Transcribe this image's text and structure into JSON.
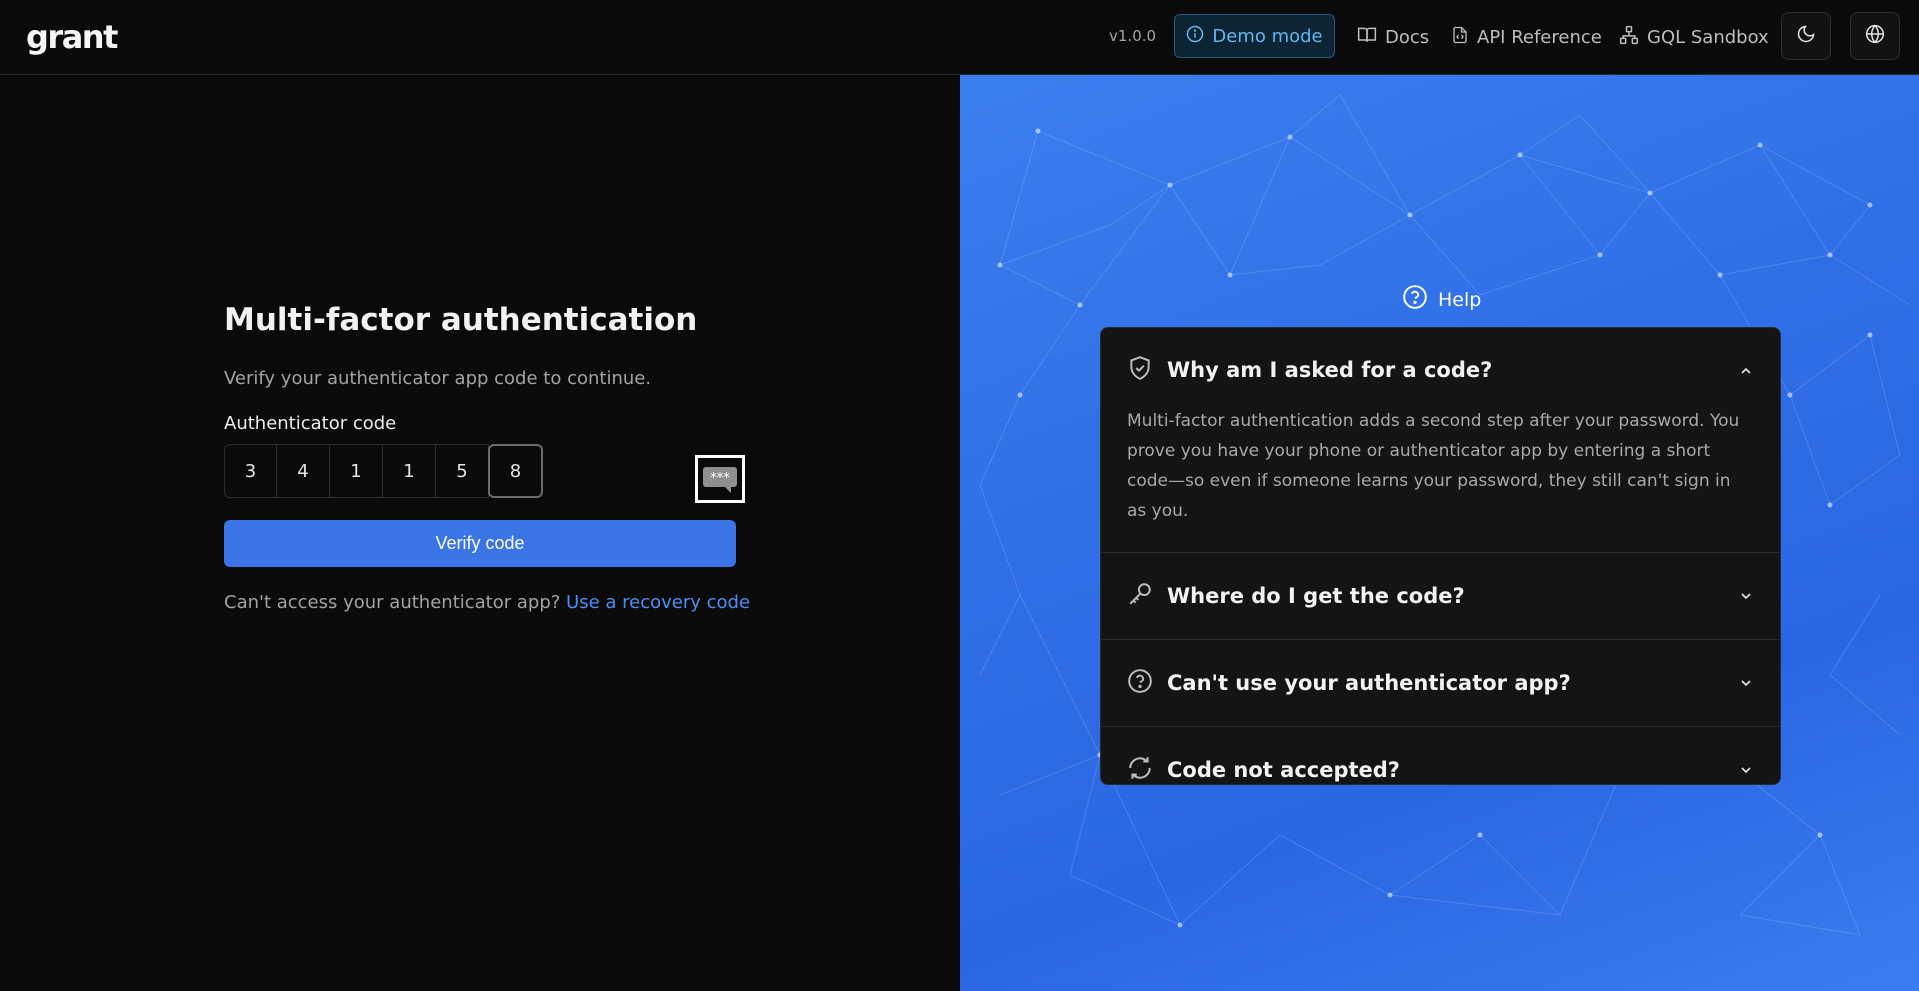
{
  "header": {
    "logo": "grant",
    "version": "v1.0.0",
    "demo_mode": "Demo mode",
    "links": {
      "docs": "Docs",
      "api_reference": "API Reference",
      "gql_sandbox": "GQL Sandbox"
    },
    "icons": {
      "theme_toggle": "moon-icon",
      "language": "globe-icon"
    }
  },
  "mfa": {
    "title": "Multi-factor authentication",
    "subtitle": "Verify your authenticator app code to continue.",
    "code_label": "Authenticator code",
    "digits": [
      "3",
      "4",
      "1",
      "1",
      "5",
      "8"
    ],
    "verify_label": "Verify code",
    "recovery_prompt": "Can't access your authenticator app?",
    "recovery_link": "Use a recovery code",
    "password_manager_icon": "password-manager-icon"
  },
  "help": {
    "label": "Help",
    "items": [
      {
        "icon": "shield-check-icon",
        "question": "Why am I asked for a code?",
        "expanded": true,
        "answer": "Multi-factor authentication adds a second step after your password. You prove you have your phone or authenticator app by entering a short code—so even if someone learns your password, they still can't sign in as you."
      },
      {
        "icon": "key-icon",
        "question": "Where do I get the code?",
        "expanded": false
      },
      {
        "icon": "question-circle-icon",
        "question": "Can't use your authenticator app?",
        "expanded": false
      },
      {
        "icon": "refresh-icon",
        "question": "Code not accepted?",
        "expanded": false
      }
    ]
  },
  "colors": {
    "accent": "#3a74e5",
    "link": "#4f8ef7",
    "background": "#0a0a0a",
    "panel_blue": "#2f6fe6"
  }
}
